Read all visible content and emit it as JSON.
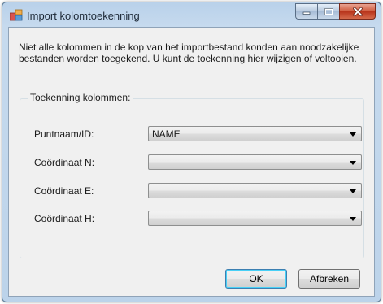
{
  "window": {
    "title": "Import kolomtoekenning",
    "icon": "import-table-icon"
  },
  "caption_buttons": {
    "minimize_icon": "minimize-icon",
    "maximize_icon": "maximize-icon",
    "close_icon": "close-icon",
    "close_color": "#c4432a"
  },
  "intro_text": "Niet alle kolommen in de kop van het importbestand konden aan noodzakelijke bestanden worden toegekend. U kunt de toekenning hier wijzigen of voltooien.",
  "group": {
    "label": "Toekenning kolommen:",
    "rows": [
      {
        "label": "Puntnaam/ID:",
        "value": "NAME"
      },
      {
        "label": "Coördinaat N:",
        "value": ""
      },
      {
        "label": "Coördinaat E:",
        "value": ""
      },
      {
        "label": "Coördinaat H:",
        "value": ""
      }
    ]
  },
  "buttons": {
    "ok": "OK",
    "cancel": "Afbreken"
  }
}
